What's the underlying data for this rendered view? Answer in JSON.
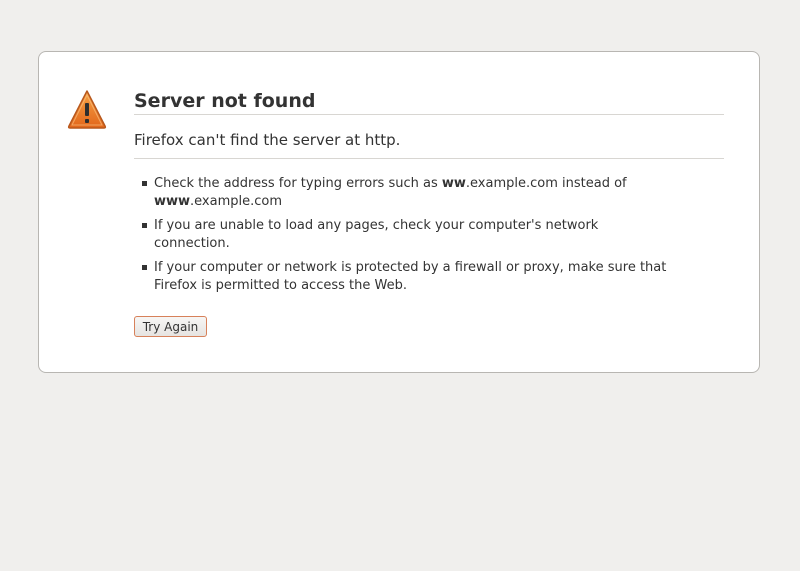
{
  "error": {
    "title": "Server not found",
    "message": "Firefox can't find the server at http.",
    "icon": "warning-triangle-icon",
    "icon_color": "#e87a2a",
    "tips": {
      "tip1": {
        "prefix": "Check the address for typing errors such as ",
        "bad_bold": "ww",
        "bad_rest": ".example.com instead of",
        "good_bold": "www",
        "good_rest": ".example.com"
      },
      "tip2": "If you are unable to load any pages, check your computer's network connection.",
      "tip3": "If your computer or network is protected by a firewall or proxy, make sure that Firefox is permitted to access the Web."
    },
    "try_again_label": "Try Again"
  }
}
